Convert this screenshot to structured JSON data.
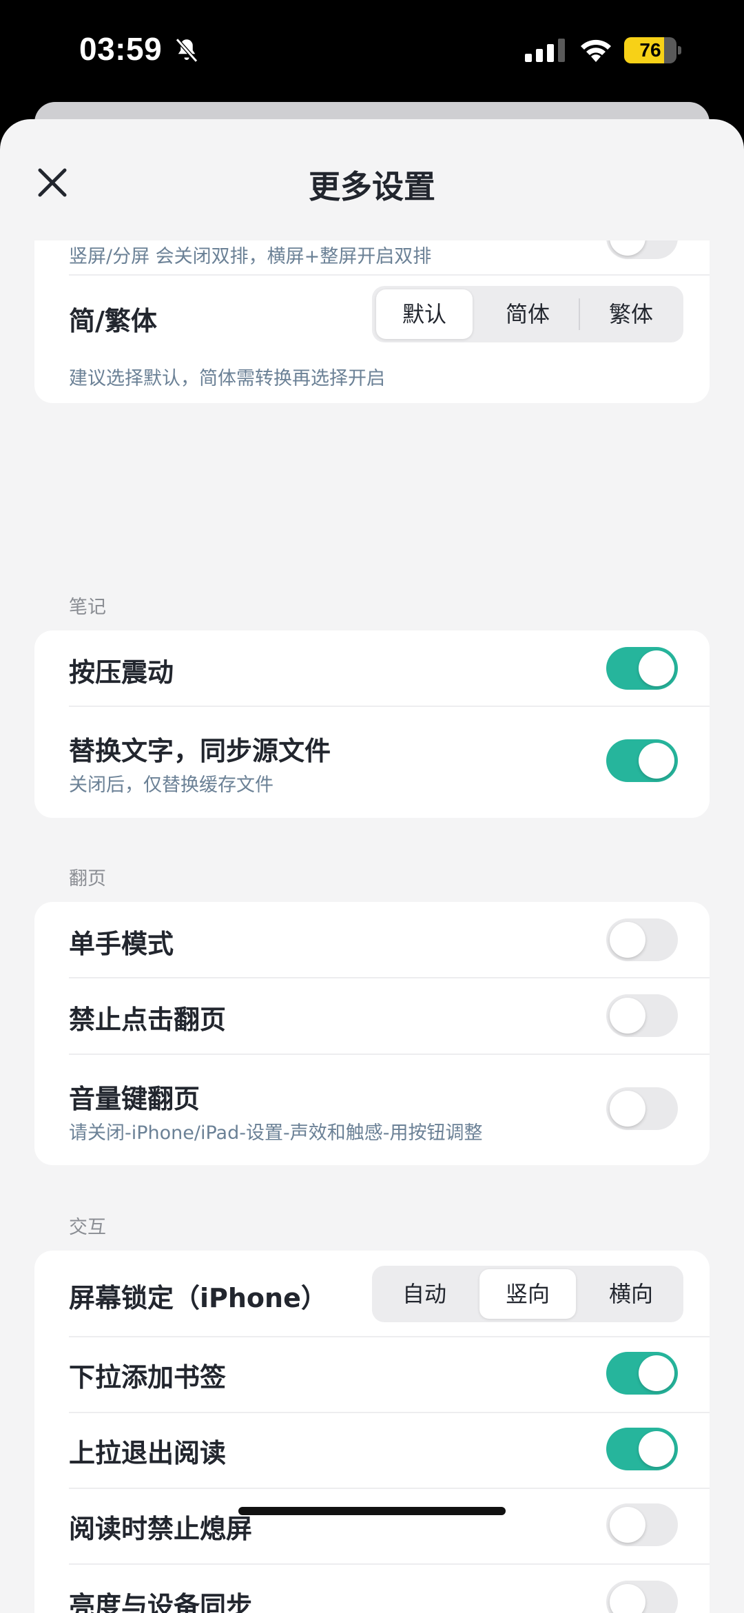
{
  "status": {
    "time": "03:59",
    "battery": "76",
    "battery_level": 0.76,
    "icons": [
      "bell-slash-icon",
      "cellular-signal-icon",
      "wifi-icon",
      "battery-icon"
    ]
  },
  "nav": {
    "title": "更多设置",
    "close_icon": "close-icon"
  },
  "colors": {
    "accent": "#26b59c",
    "background": "#f4f4f5",
    "card": "#ffffff",
    "subtext": "#6b8196"
  },
  "display_card": {
    "partial_subtitle": "竖屏/分屏 会关闭双排，横屏+整屏开启双排",
    "script": {
      "title": "简/繁体",
      "options": [
        "默认",
        "简体",
        "繁体"
      ],
      "selected": "默认",
      "subtitle": "建议选择默认，简体需转换再选择开启"
    }
  },
  "notes": {
    "section": "笔记",
    "items": [
      {
        "title": "按压震动",
        "on": true
      },
      {
        "title": "替换文字，同步源文件",
        "subtitle": "关闭后，仅替换缓存文件",
        "on": true
      }
    ]
  },
  "paging": {
    "section": "翻页",
    "items": [
      {
        "title": "单手模式",
        "on": false
      },
      {
        "title": "禁止点击翻页",
        "on": false
      },
      {
        "title": "音量键翻页",
        "subtitle": "请关闭-iPhone/iPad-设置-声效和触感-用按钮调整",
        "on": false
      }
    ]
  },
  "interaction": {
    "section": "交互",
    "lock": {
      "title": "屏幕锁定（iPhone）",
      "options": [
        "自动",
        "竖向",
        "横向"
      ],
      "selected": "竖向"
    },
    "items": [
      {
        "title": "下拉添加书签",
        "on": true
      },
      {
        "title": "上拉退出阅读",
        "on": true
      },
      {
        "title": "阅读时禁止熄屏",
        "on": false
      },
      {
        "title": "亮度与设备同步",
        "on": false
      }
    ]
  }
}
